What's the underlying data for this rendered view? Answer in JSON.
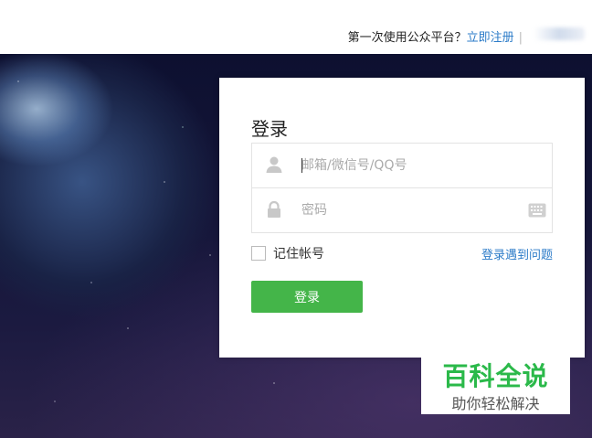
{
  "header": {
    "prompt": "第一次使用公众平台？",
    "register_link": "立即注册",
    "separator": "|"
  },
  "login": {
    "title": "登录",
    "account_placeholder": "邮箱/微信号/QQ号",
    "password_placeholder": "密码",
    "remember_label": "记住帐号",
    "trouble_link": "登录遇到问题",
    "submit_label": "登录"
  },
  "icons": {
    "account": "user-icon",
    "password": "lock-icon",
    "keyboard": "keyboard-icon"
  },
  "watermark": {
    "title": "百科全说",
    "subtitle": "助你轻松解决"
  },
  "colors": {
    "primary_green": "#44b549",
    "link_blue": "#2b7bc8",
    "watermark_green": "#2bb94a"
  }
}
